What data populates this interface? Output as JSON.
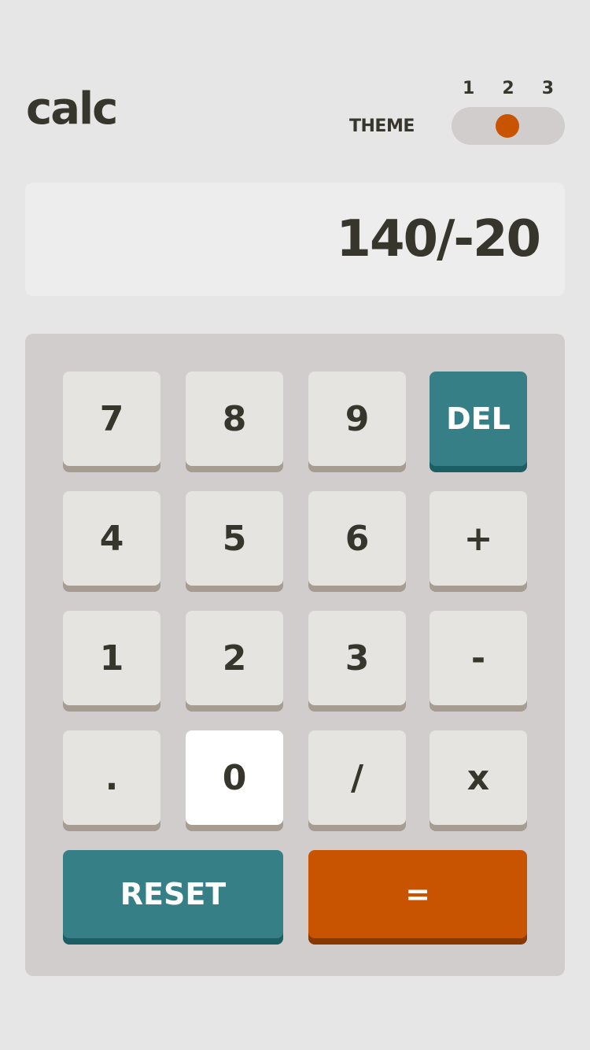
{
  "header": {
    "logo": "calc",
    "theme_label": "THEME",
    "theme_options": [
      "1",
      "2",
      "3"
    ],
    "theme_selected": "2"
  },
  "display": {
    "value": "140/-20"
  },
  "keypad": {
    "row1": [
      "7",
      "8",
      "9",
      "DEL"
    ],
    "row2": [
      "4",
      "5",
      "6",
      "+"
    ],
    "row3": [
      "1",
      "2",
      "3",
      "-"
    ],
    "row4": [
      ".",
      "0",
      "/",
      "x"
    ],
    "reset": "RESET",
    "equals": "="
  },
  "colors": {
    "background": "#e6e6e6",
    "keypad_bg": "#d2cdcd",
    "screen_bg": "#ededed",
    "key_bg": "#e5e4e1",
    "key_shadow": "#a69c91",
    "accent_teal": "#377f86",
    "accent_teal_shadow": "#1b5f65",
    "accent_orange": "#c85402",
    "accent_orange_shadow": "#873901",
    "text": "#37362c"
  }
}
